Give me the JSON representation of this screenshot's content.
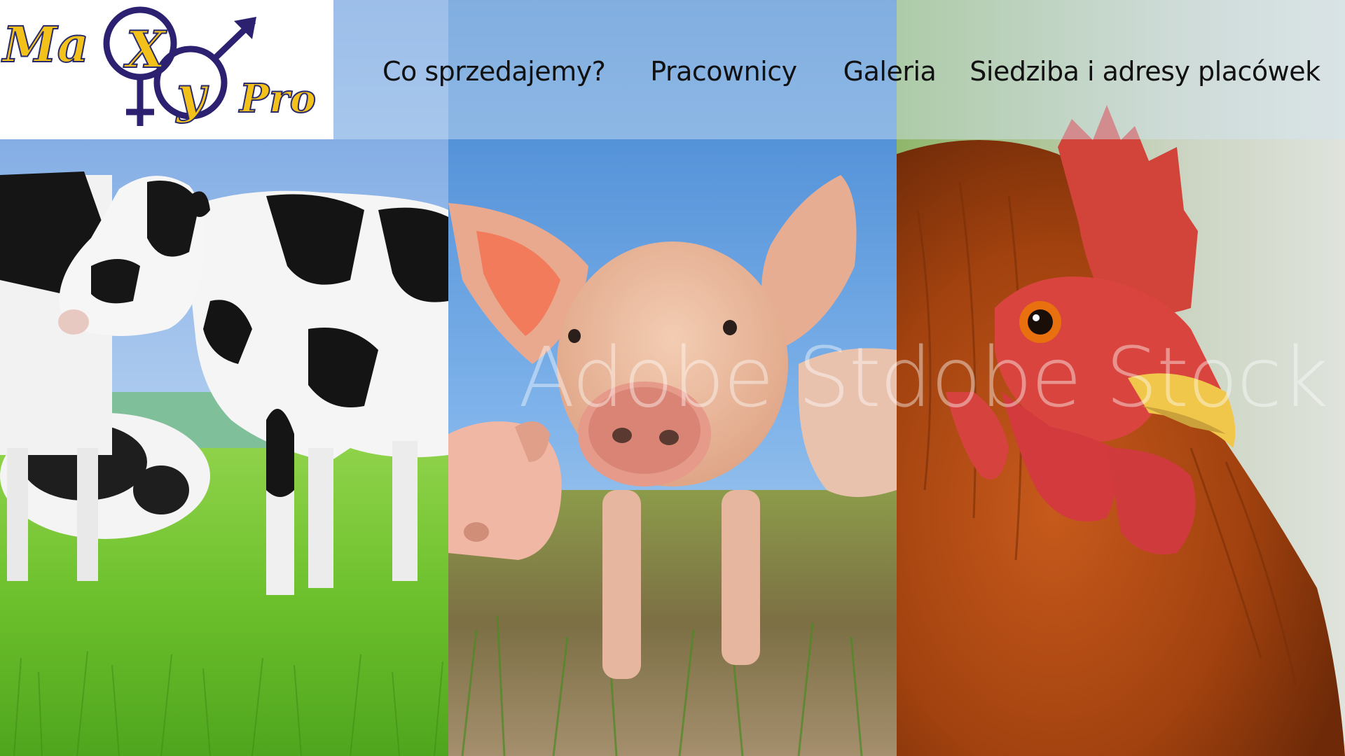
{
  "logo": {
    "text_part1": "Ma",
    "text_x": "X",
    "text_y": "y",
    "text_part2": "Pro",
    "colors": {
      "text_fill": "#f2c21b",
      "text_stroke": "#2a2a6e",
      "symbols": "#2b2170"
    }
  },
  "nav": {
    "items": [
      {
        "label": "Co sprzedajemy?"
      },
      {
        "label": "Pracownicy"
      },
      {
        "label": "Galeria"
      },
      {
        "label": "Siedziba i adresy placówek"
      }
    ]
  },
  "hero": {
    "watermark": "Adobe Stdobe Stock",
    "panels": [
      {
        "subject": "cows-photo"
      },
      {
        "subject": "pig-photo"
      },
      {
        "subject": "rooster-photo"
      }
    ]
  }
}
